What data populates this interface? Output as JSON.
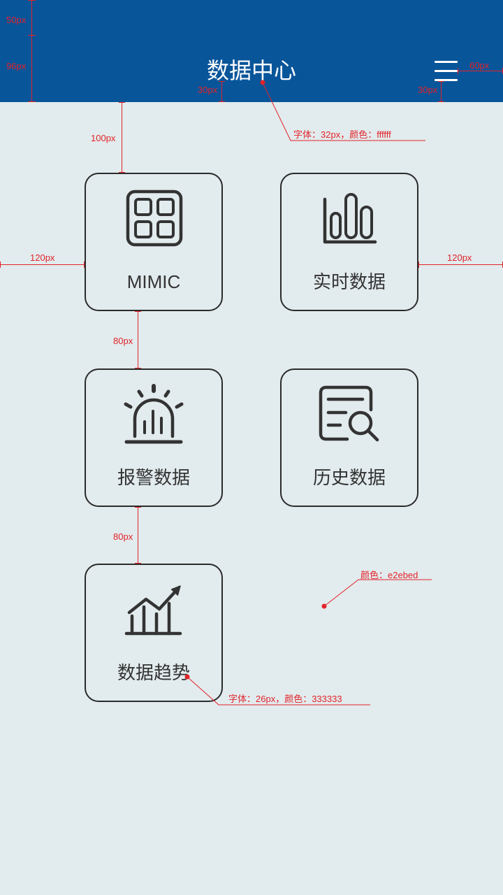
{
  "colors": {
    "header_background": "#08559a",
    "page_background": "#e2ebed",
    "title_text": "#ffffff",
    "tile_text": "#333333",
    "tile_border": "#2b2b2b",
    "annotation": "#e2232a"
  },
  "header": {
    "title": "数据中心",
    "menu_icon": "hamburger-menu-icon"
  },
  "tiles": [
    {
      "label": "MIMIC",
      "icon": "grid-icon"
    },
    {
      "label": "实时数据",
      "icon": "bar-chart-icon"
    },
    {
      "label": "报警数据",
      "icon": "alarm-siren-icon"
    },
    {
      "label": "历史数据",
      "icon": "document-search-icon"
    },
    {
      "label": "数据趋势",
      "icon": "trend-chart-icon"
    }
  ],
  "annotations": {
    "status_bar": "50px",
    "nav_bar": "96px",
    "title_bottom": "30px",
    "menu_bottom": "30px",
    "menu_right": "60px",
    "header_to_tiles": "100px",
    "left_margin": "120px",
    "right_margin": "120px",
    "row_gap_1": "80px",
    "row_gap_2": "80px",
    "title_style": "字体：32px，颜色：ffffff",
    "background_style": "颜色：e2ebed",
    "label_style": "字体：26px，颜色：333333"
  }
}
